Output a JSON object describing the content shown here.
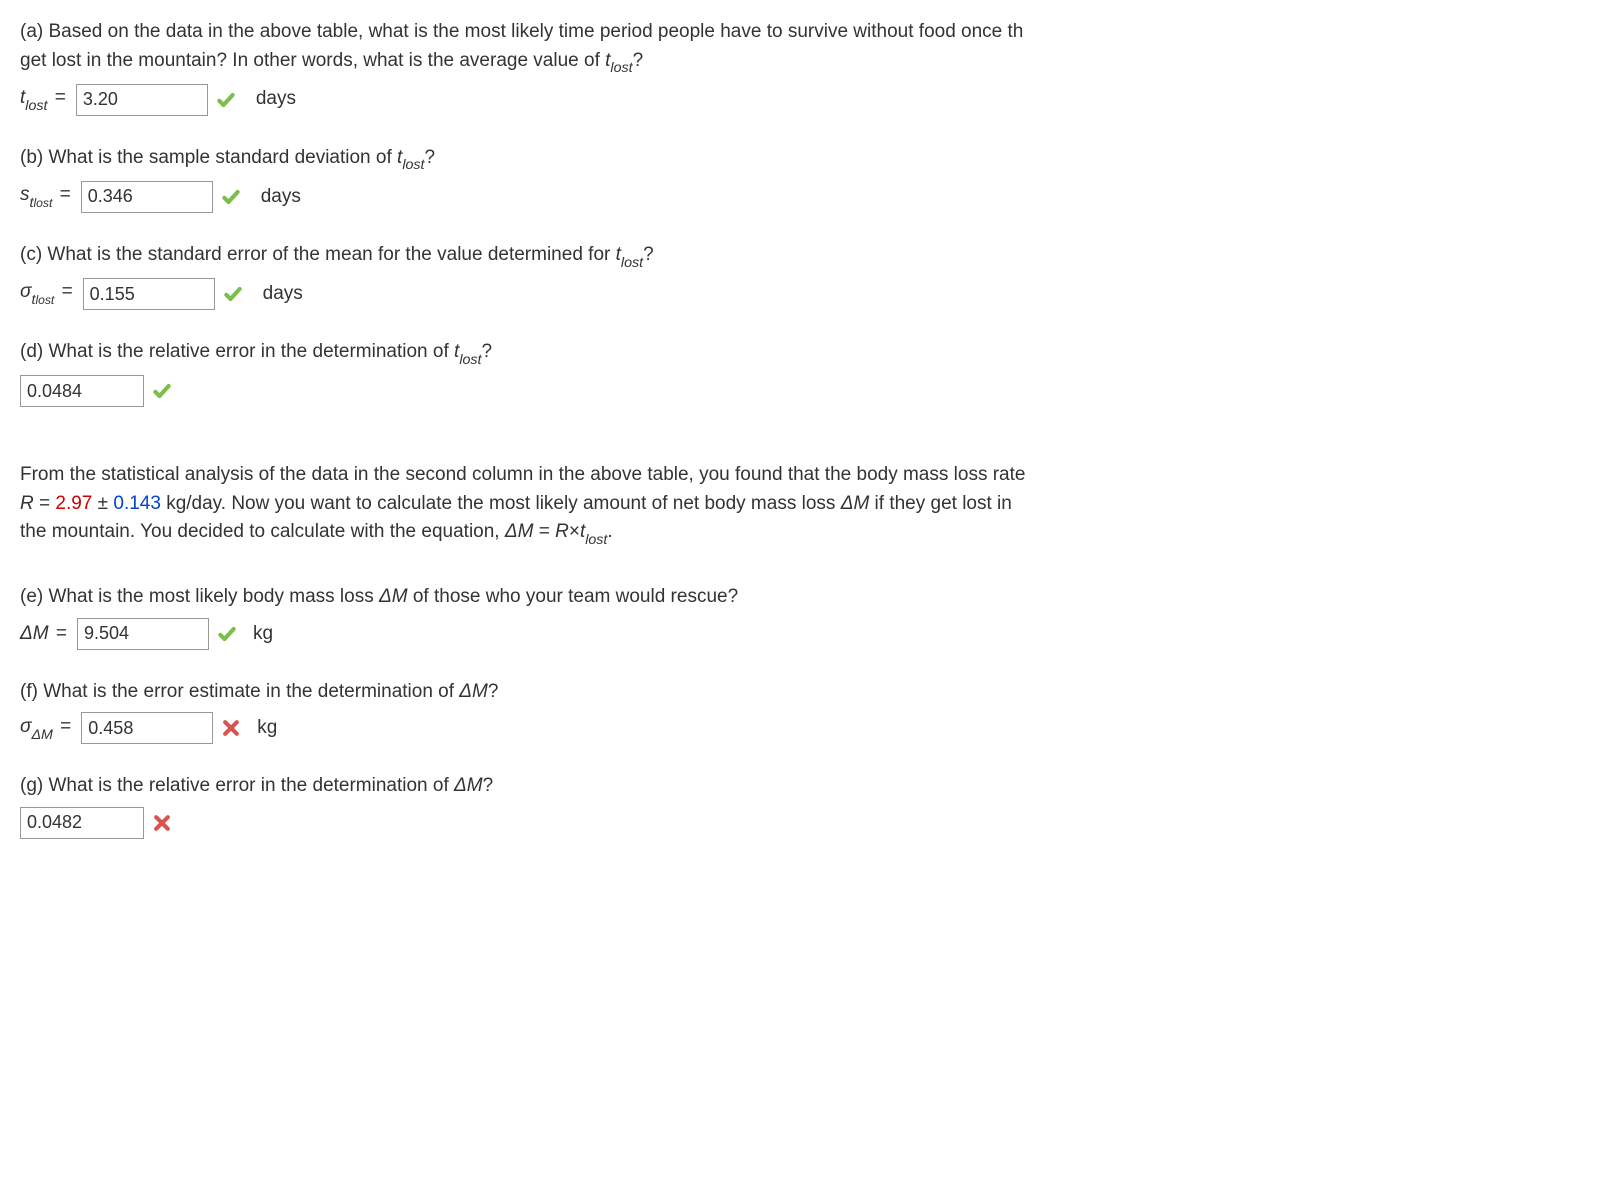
{
  "parts": {
    "a": {
      "text1": "(a) Based on the data in the above table, what is the most likely time period people have to survive without food once th",
      "text2": "get lost in the mountain? In other words, what is the average value of ",
      "var_t": "t",
      "var_lost": "lost",
      "qmark": "?",
      "varlabel_t": "t",
      "varlabel_lost": "lost",
      "eq": " = ",
      "value": "3.20",
      "unit": "days"
    },
    "b": {
      "text": "(b) What is the sample standard deviation of ",
      "var_t": "t",
      "var_lost": "lost",
      "qmark": "?",
      "varlabel_s": "s",
      "varlabel_t": "t",
      "varlabel_lost": "lost",
      "eq": " = ",
      "value": "0.346",
      "unit": "days"
    },
    "c": {
      "text": "(c) What is the standard error of the mean for the value determined for ",
      "var_t": "t",
      "var_lost": "lost",
      "qmark": "?",
      "varlabel_sigma": "σ",
      "varlabel_t": "t",
      "varlabel_lost": "lost",
      "eq": " = ",
      "value": "0.155",
      "unit": "days"
    },
    "d": {
      "text": "(d) What is the relative error in the determination of ",
      "var_t": "t",
      "var_lost": "lost",
      "qmark": "?",
      "value": "0.0484"
    },
    "intro": {
      "line1a": "From the statistical analysis of the data in the second column in the above table, you found that the body mass loss rate",
      "line2a": "R",
      "line2b": " = ",
      "Rval": "2.97",
      "pm": " ± ",
      "Rerr": "0.143",
      "line2c": " kg/day. Now you want to calculate the most likely amount of net body mass loss ",
      "dM": "Δ",
      "M": "M",
      "line2d": " if they get lost in",
      "line3a": "the mountain. You decided to calculate with the equation, ",
      "dM2": "Δ",
      "M2": "M",
      "eq2": " = ",
      "R2": "R",
      "times": "×",
      "t2": "t",
      "lost2": "lost",
      "period": "."
    },
    "e": {
      "text": "(e) What is the most likely body mass loss ",
      "dM": "Δ",
      "M": "M",
      "text2": " of those who your team would rescue?",
      "varlabel_dM": "Δ",
      "varlabel_M": "M",
      "eq": " = ",
      "value": "9.504",
      "unit": "kg"
    },
    "f": {
      "text": "(f) What is the error estimate in the determination of ",
      "dM": "Δ",
      "M": "M",
      "qmark": "?",
      "varlabel_sigma": "σ",
      "varlabel_dM": "Δ",
      "varlabel_M": "M",
      "eq": " = ",
      "value": "0.458",
      "unit": "kg"
    },
    "g": {
      "text": "(g) What is the relative error in the determination of ",
      "dM": "Δ",
      "M": "M",
      "qmark": "?",
      "value": "0.0482"
    }
  }
}
